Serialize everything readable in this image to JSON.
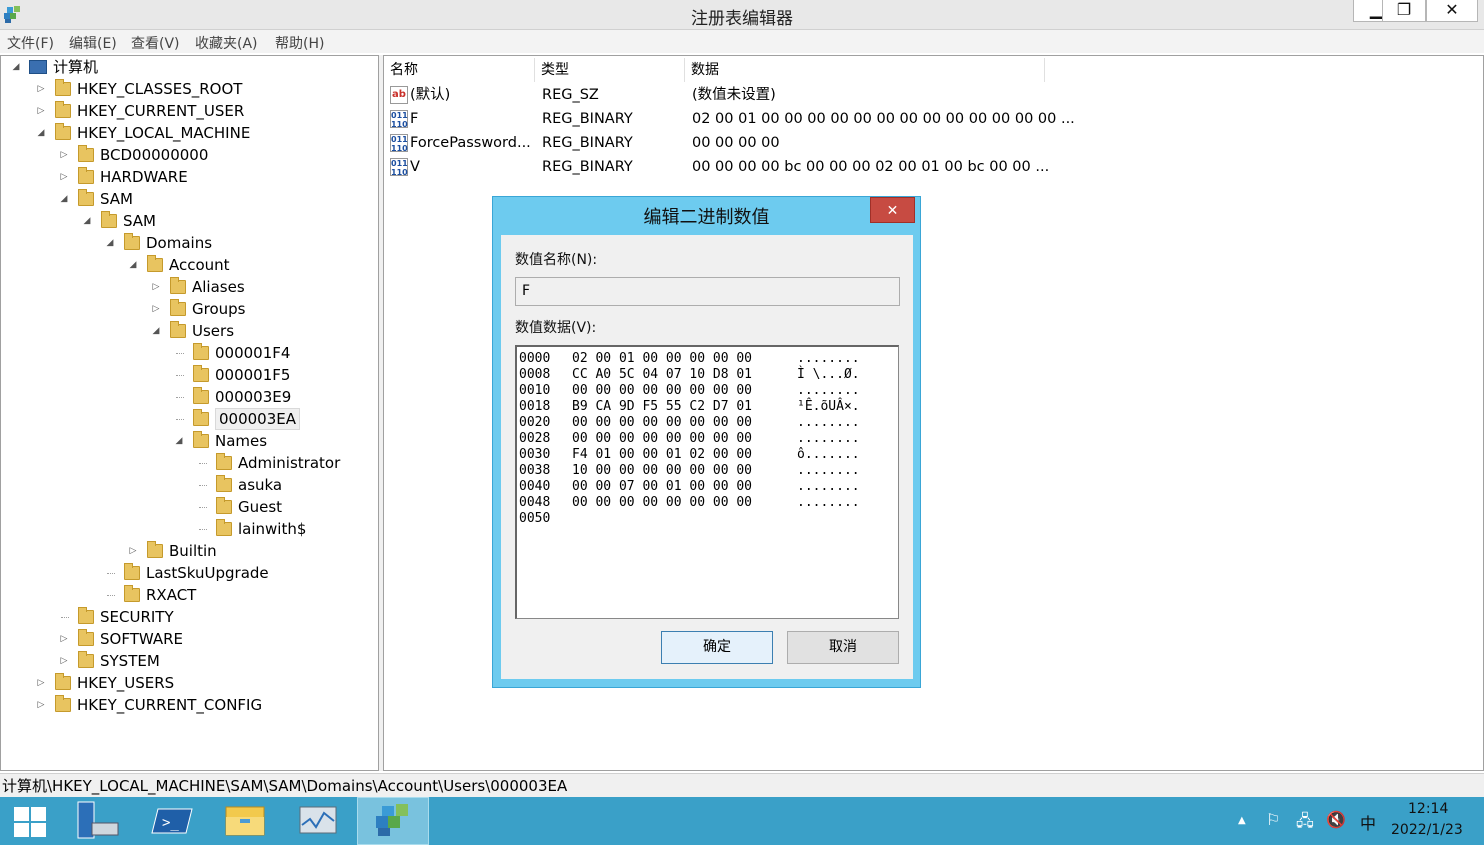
{
  "window": {
    "title": "注册表编辑器",
    "minimize": "▁",
    "maximize": "❐",
    "close": "✕"
  },
  "menu": [
    "文件(F)",
    "编辑(E)",
    "查看(V)",
    "收藏夹(A)",
    "帮助(H)"
  ],
  "tree": {
    "root": "计算机",
    "nodes": [
      {
        "label": "HKEY_CLASSES_ROOT",
        "level": 1,
        "expander": "closed"
      },
      {
        "label": "HKEY_CURRENT_USER",
        "level": 1,
        "expander": "closed"
      },
      {
        "label": "HKEY_LOCAL_MACHINE",
        "level": 1,
        "expander": "open"
      },
      {
        "label": "BCD00000000",
        "level": 2,
        "expander": "closed"
      },
      {
        "label": "HARDWARE",
        "level": 2,
        "expander": "closed"
      },
      {
        "label": "SAM",
        "level": 2,
        "expander": "open"
      },
      {
        "label": "SAM",
        "level": 3,
        "expander": "open"
      },
      {
        "label": "Domains",
        "level": 4,
        "expander": "open"
      },
      {
        "label": "Account",
        "level": 5,
        "expander": "open"
      },
      {
        "label": "Aliases",
        "level": 6,
        "expander": "closed"
      },
      {
        "label": "Groups",
        "level": 6,
        "expander": "closed"
      },
      {
        "label": "Users",
        "level": 6,
        "expander": "open"
      },
      {
        "label": "000001F4",
        "level": 7,
        "expander": "none"
      },
      {
        "label": "000001F5",
        "level": 7,
        "expander": "none"
      },
      {
        "label": "000003E9",
        "level": 7,
        "expander": "none"
      },
      {
        "label": "000003EA",
        "level": 7,
        "expander": "none",
        "selected": true
      },
      {
        "label": "Names",
        "level": 7,
        "expander": "open"
      },
      {
        "label": "Administrator",
        "level": 8,
        "expander": "none"
      },
      {
        "label": "asuka",
        "level": 8,
        "expander": "none"
      },
      {
        "label": "Guest",
        "level": 8,
        "expander": "none"
      },
      {
        "label": "lainwith$",
        "level": 8,
        "expander": "none"
      },
      {
        "label": "Builtin",
        "level": 5,
        "expander": "closed"
      },
      {
        "label": "LastSkuUpgrade",
        "level": 4,
        "expander": "none"
      },
      {
        "label": "RXACT",
        "level": 4,
        "expander": "none"
      },
      {
        "label": "SECURITY",
        "level": 2,
        "expander": "none"
      },
      {
        "label": "SOFTWARE",
        "level": 2,
        "expander": "closed"
      },
      {
        "label": "SYSTEM",
        "level": 2,
        "expander": "closed"
      },
      {
        "label": "HKEY_USERS",
        "level": 1,
        "expander": "closed"
      },
      {
        "label": "HKEY_CURRENT_CONFIG",
        "level": 1,
        "expander": "closed"
      }
    ]
  },
  "list": {
    "headers": {
      "name": "名称",
      "type": "类型",
      "data": "数据"
    },
    "rows": [
      {
        "icon": "string-value-icon",
        "glyph": "ab",
        "name": "(默认)",
        "type": "REG_SZ",
        "data": "(数值未设置)"
      },
      {
        "icon": "binary-value-icon",
        "glyph": "011\n110",
        "name": "F",
        "type": "REG_BINARY",
        "data": "02 00 01 00 00 00 00 00 00 00 00 00 00 00 00 00 ..."
      },
      {
        "icon": "binary-value-icon",
        "glyph": "011\n110",
        "name": "ForcePassword...",
        "type": "REG_BINARY",
        "data": "00 00 00 00"
      },
      {
        "icon": "binary-value-icon",
        "glyph": "011\n110",
        "name": "V",
        "type": "REG_BINARY",
        "data": "00 00 00 00 bc 00 00 00 02 00 01 00 bc 00 00 ..."
      }
    ]
  },
  "dialog": {
    "title": "编辑二进制数值",
    "close": "✕",
    "name_label": "数值名称(N):",
    "name_value": "F",
    "data_label": "数值数据(V):",
    "hex_lines": [
      {
        "offset": "0000",
        "bytes": "02 00 01 00 00 00 00 00",
        "ascii": "........"
      },
      {
        "offset": "0008",
        "bytes": "CC A0 5C 04 07 10 D8 01",
        "ascii": "Ì \\...Ø."
      },
      {
        "offset": "0010",
        "bytes": "00 00 00 00 00 00 00 00",
        "ascii": "........"
      },
      {
        "offset": "0018",
        "bytes": "B9 CA 9D F5 55 C2 D7 01",
        "ascii": "¹Ê.õUÂ×."
      },
      {
        "offset": "0020",
        "bytes": "00 00 00 00 00 00 00 00",
        "ascii": "........"
      },
      {
        "offset": "0028",
        "bytes": "00 00 00 00 00 00 00 00",
        "ascii": "........"
      },
      {
        "offset": "0030",
        "bytes": "F4 01 00 00 01 02 00 00",
        "ascii": "ô......."
      },
      {
        "offset": "0038",
        "bytes": "10 00 00 00 00 00 00 00",
        "ascii": "........"
      },
      {
        "offset": "0040",
        "bytes": "00 00 07 00 01 00 00 00",
        "ascii": "........"
      },
      {
        "offset": "0048",
        "bytes": "00 00 00 00 00 00 00 00",
        "ascii": "........"
      },
      {
        "offset": "0050",
        "bytes": "",
        "ascii": ""
      }
    ],
    "ok": "确定",
    "cancel": "取消"
  },
  "statusbar": {
    "path": "计算机\\HKEY_LOCAL_MACHINE\\SAM\\SAM\\Domains\\Account\\Users\\000003EA"
  },
  "taskbar": {
    "items": [
      "start-icon",
      "server-manager-icon",
      "powershell-icon",
      "file-explorer-icon",
      "performance-monitor-icon",
      "registry-editor-icon"
    ],
    "tray": {
      "show_hidden": "▲",
      "flag": "⚐",
      "network": "🖧",
      "volume": "🔇",
      "ime": "中"
    },
    "time": "12:14",
    "date": "2022/1/23"
  }
}
